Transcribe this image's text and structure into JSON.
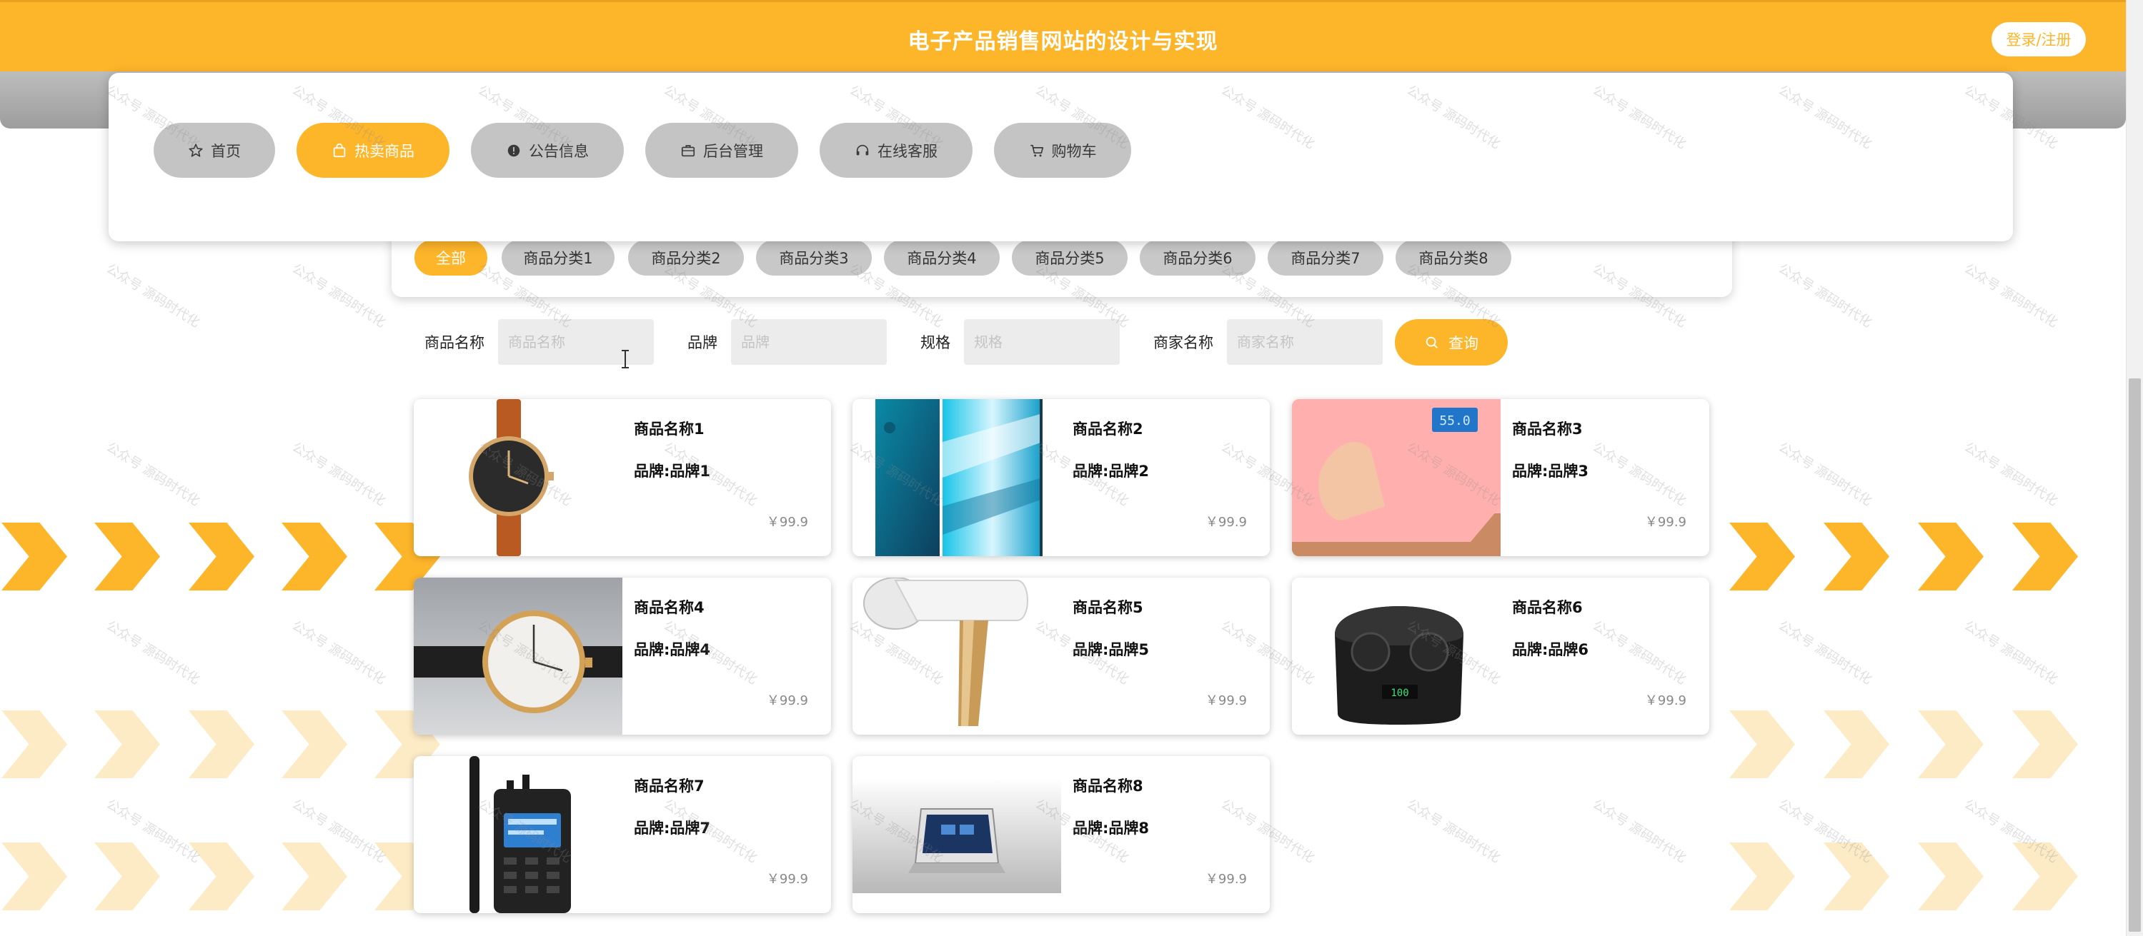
{
  "header": {
    "title": "电子产品销售网站的设计与实现",
    "login_label": "登录/注册"
  },
  "nav": {
    "items": [
      {
        "label": "首页",
        "icon": "star-icon"
      },
      {
        "label": "热卖商品",
        "icon": "shopping-bag-icon"
      },
      {
        "label": "公告信息",
        "icon": "info-icon"
      },
      {
        "label": "后台管理",
        "icon": "briefcase-icon"
      },
      {
        "label": "在线客服",
        "icon": "headset-icon"
      },
      {
        "label": "购物车",
        "icon": "cart-icon"
      }
    ],
    "active_index": 1
  },
  "categories": {
    "items": [
      "全部",
      "商品分类1",
      "商品分类2",
      "商品分类3",
      "商品分类4",
      "商品分类5",
      "商品分类6",
      "商品分类7",
      "商品分类8"
    ],
    "active_index": 0
  },
  "search": {
    "name_label": "商品名称",
    "name_placeholder": "商品名称",
    "brand_label": "品牌",
    "brand_placeholder": "品牌",
    "spec_label": "规格",
    "spec_placeholder": "规格",
    "merchant_label": "商家名称",
    "merchant_placeholder": "商家名称",
    "query_label": "查询"
  },
  "products": [
    {
      "name": "商品名称1",
      "brand": "品牌:品牌1",
      "price": "￥99.9",
      "image": "watch-black"
    },
    {
      "name": "商品名称2",
      "brand": "品牌:品牌2",
      "price": "￥99.9",
      "image": "phone-blue"
    },
    {
      "name": "商品名称3",
      "brand": "品牌:品牌3",
      "price": "￥99.9",
      "image": "scale-pink"
    },
    {
      "name": "商品名称4",
      "brand": "品牌:品牌4",
      "price": "￥99.9",
      "image": "watch-white"
    },
    {
      "name": "商品名称5",
      "brand": "品牌:品牌5",
      "price": "￥99.9",
      "image": "hair-dryer"
    },
    {
      "name": "商品名称6",
      "brand": "品牌:品牌6",
      "price": "￥99.9",
      "image": "earbuds"
    },
    {
      "name": "商品名称7",
      "brand": "品牌:品牌7",
      "price": "￥99.9",
      "image": "walkie-talkie"
    },
    {
      "name": "商品名称8",
      "brand": "品牌:品牌8",
      "price": "￥99.9",
      "image": "tablet-display"
    }
  ],
  "watermark": "公众号 源码时代化",
  "colors": {
    "accent": "#fdb52a",
    "accent_light": "#fdebc6",
    "pill_gray": "#c4c4c4",
    "input_gray": "#ececec",
    "price_gray": "#888888"
  }
}
